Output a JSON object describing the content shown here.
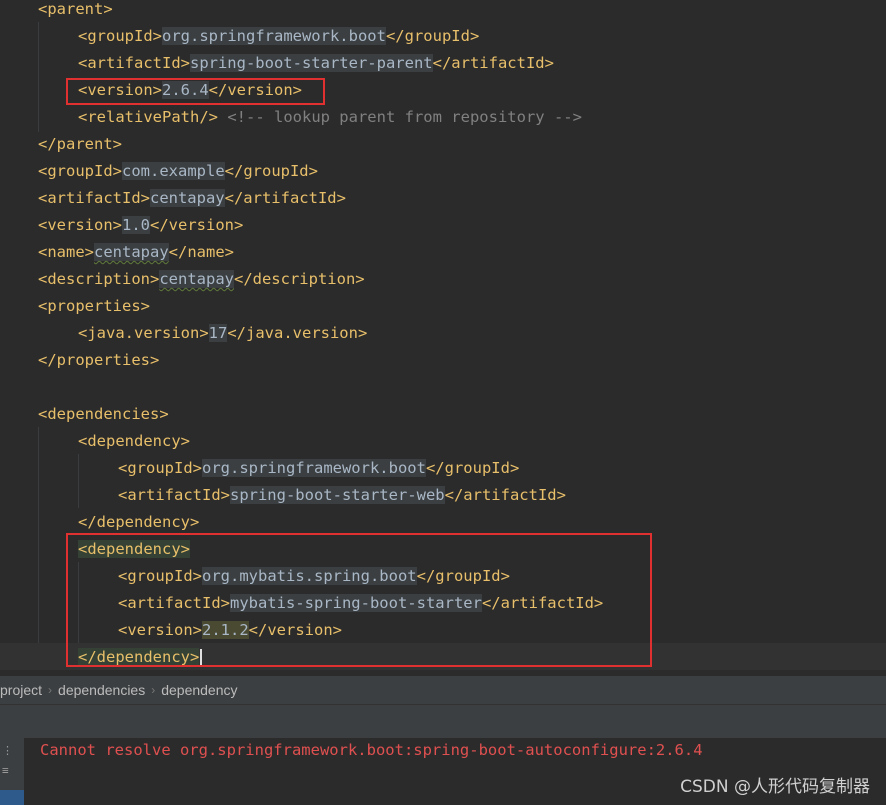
{
  "editor": {
    "lines": [
      {
        "id": "l1",
        "indent": 0,
        "parts": [
          [
            "tag",
            "<parent>"
          ]
        ]
      },
      {
        "id": "l2",
        "indent": 1,
        "parts": [
          [
            "tag",
            "<groupId>"
          ],
          [
            "val",
            "org.springframework.boot"
          ],
          [
            "tag",
            "</groupId>"
          ]
        ]
      },
      {
        "id": "l3",
        "indent": 1,
        "parts": [
          [
            "tag",
            "<artifactId>"
          ],
          [
            "val",
            "spring-boot-starter-parent"
          ],
          [
            "tag",
            "</artifactId>"
          ]
        ]
      },
      {
        "id": "l4",
        "indent": 1,
        "parts": [
          [
            "tag",
            "<version>"
          ],
          [
            "val",
            "2.6.4"
          ],
          [
            "tag",
            "</version>"
          ]
        ]
      },
      {
        "id": "l5",
        "indent": 1,
        "parts": [
          [
            "tag",
            "<relativePath/>"
          ],
          [
            "txt",
            " "
          ],
          [
            "comment",
            "<!-- lookup parent from repository -->"
          ]
        ]
      },
      {
        "id": "l6",
        "indent": 0,
        "parts": [
          [
            "tag",
            "</parent>"
          ]
        ]
      },
      {
        "id": "l7",
        "indent": 0,
        "parts": [
          [
            "tag",
            "<groupId>"
          ],
          [
            "val",
            "com.example"
          ],
          [
            "tag",
            "</groupId>"
          ]
        ]
      },
      {
        "id": "l8",
        "indent": 0,
        "parts": [
          [
            "tag",
            "<artifactId>"
          ],
          [
            "val",
            "centapay"
          ],
          [
            "tag",
            "</artifactId>"
          ]
        ]
      },
      {
        "id": "l9",
        "indent": 0,
        "parts": [
          [
            "tag",
            "<version>"
          ],
          [
            "val",
            "1.0"
          ],
          [
            "tag",
            "</version>"
          ]
        ]
      },
      {
        "id": "l10",
        "indent": 0,
        "parts": [
          [
            "tag",
            "<name>"
          ],
          [
            "valsq",
            "centapay"
          ],
          [
            "tag",
            "</name>"
          ]
        ]
      },
      {
        "id": "l11",
        "indent": 0,
        "parts": [
          [
            "tag",
            "<description>"
          ],
          [
            "valsq",
            "centapay"
          ],
          [
            "tag",
            "</description>"
          ]
        ]
      },
      {
        "id": "l12",
        "indent": 0,
        "parts": [
          [
            "tag",
            "<properties>"
          ]
        ]
      },
      {
        "id": "l13",
        "indent": 1,
        "parts": [
          [
            "tag",
            "<java.version>"
          ],
          [
            "val",
            "17"
          ],
          [
            "tag",
            "</java.version>"
          ]
        ]
      },
      {
        "id": "l14",
        "indent": 0,
        "parts": [
          [
            "tag",
            "</properties>"
          ]
        ]
      },
      {
        "id": "l15",
        "indent": 0,
        "parts": []
      },
      {
        "id": "l16",
        "indent": 0,
        "parts": [
          [
            "tag",
            "<dependencies>"
          ]
        ]
      },
      {
        "id": "l17",
        "indent": 1,
        "parts": [
          [
            "tag",
            "<dependency>"
          ]
        ]
      },
      {
        "id": "l18",
        "indent": 2,
        "parts": [
          [
            "tag",
            "<groupId>"
          ],
          [
            "val",
            "org.springframework.boot"
          ],
          [
            "tag",
            "</groupId>"
          ]
        ]
      },
      {
        "id": "l19",
        "indent": 2,
        "parts": [
          [
            "tag",
            "<artifactId>"
          ],
          [
            "val",
            "spring-boot-starter-web"
          ],
          [
            "tag",
            "</artifactId>"
          ]
        ]
      },
      {
        "id": "l20",
        "indent": 1,
        "parts": [
          [
            "tag",
            "</dependency>"
          ]
        ]
      },
      {
        "id": "l21",
        "indent": 1,
        "parts": [
          [
            "taggreen",
            "<dependency>"
          ]
        ]
      },
      {
        "id": "l22",
        "indent": 2,
        "parts": [
          [
            "tag",
            "<groupId>"
          ],
          [
            "val",
            "org.mybatis.spring.boot"
          ],
          [
            "tag",
            "</groupId>"
          ]
        ]
      },
      {
        "id": "l23",
        "indent": 2,
        "parts": [
          [
            "tag",
            "<artifactId>"
          ],
          [
            "val",
            "mybatis-spring-boot-starter"
          ],
          [
            "tag",
            "</artifactId>"
          ]
        ]
      },
      {
        "id": "l24",
        "indent": 2,
        "parts": [
          [
            "tag",
            "<version>"
          ],
          [
            "valolive",
            "2.1.2"
          ],
          [
            "tag",
            "</version>"
          ]
        ]
      },
      {
        "id": "l25",
        "indent": 1,
        "parts": [
          [
            "taggreen",
            "</dependency>"
          ],
          [
            "caret",
            ""
          ]
        ]
      }
    ]
  },
  "breadcrumb": {
    "items": [
      "project",
      "dependencies",
      "dependency"
    ],
    "separator": "›"
  },
  "problems": {
    "message": "Cannot resolve org.springframework.boot:spring-boot-autoconfigure:2.6.4"
  },
  "watermark": "CSDN @人形代码复制器",
  "colors": {
    "background": "#2b2b2b",
    "tag": "#e8bf6a",
    "text": "#a9b7c6",
    "comment": "#808080",
    "error": "#e05050",
    "highlight_box": "#e0302f"
  }
}
